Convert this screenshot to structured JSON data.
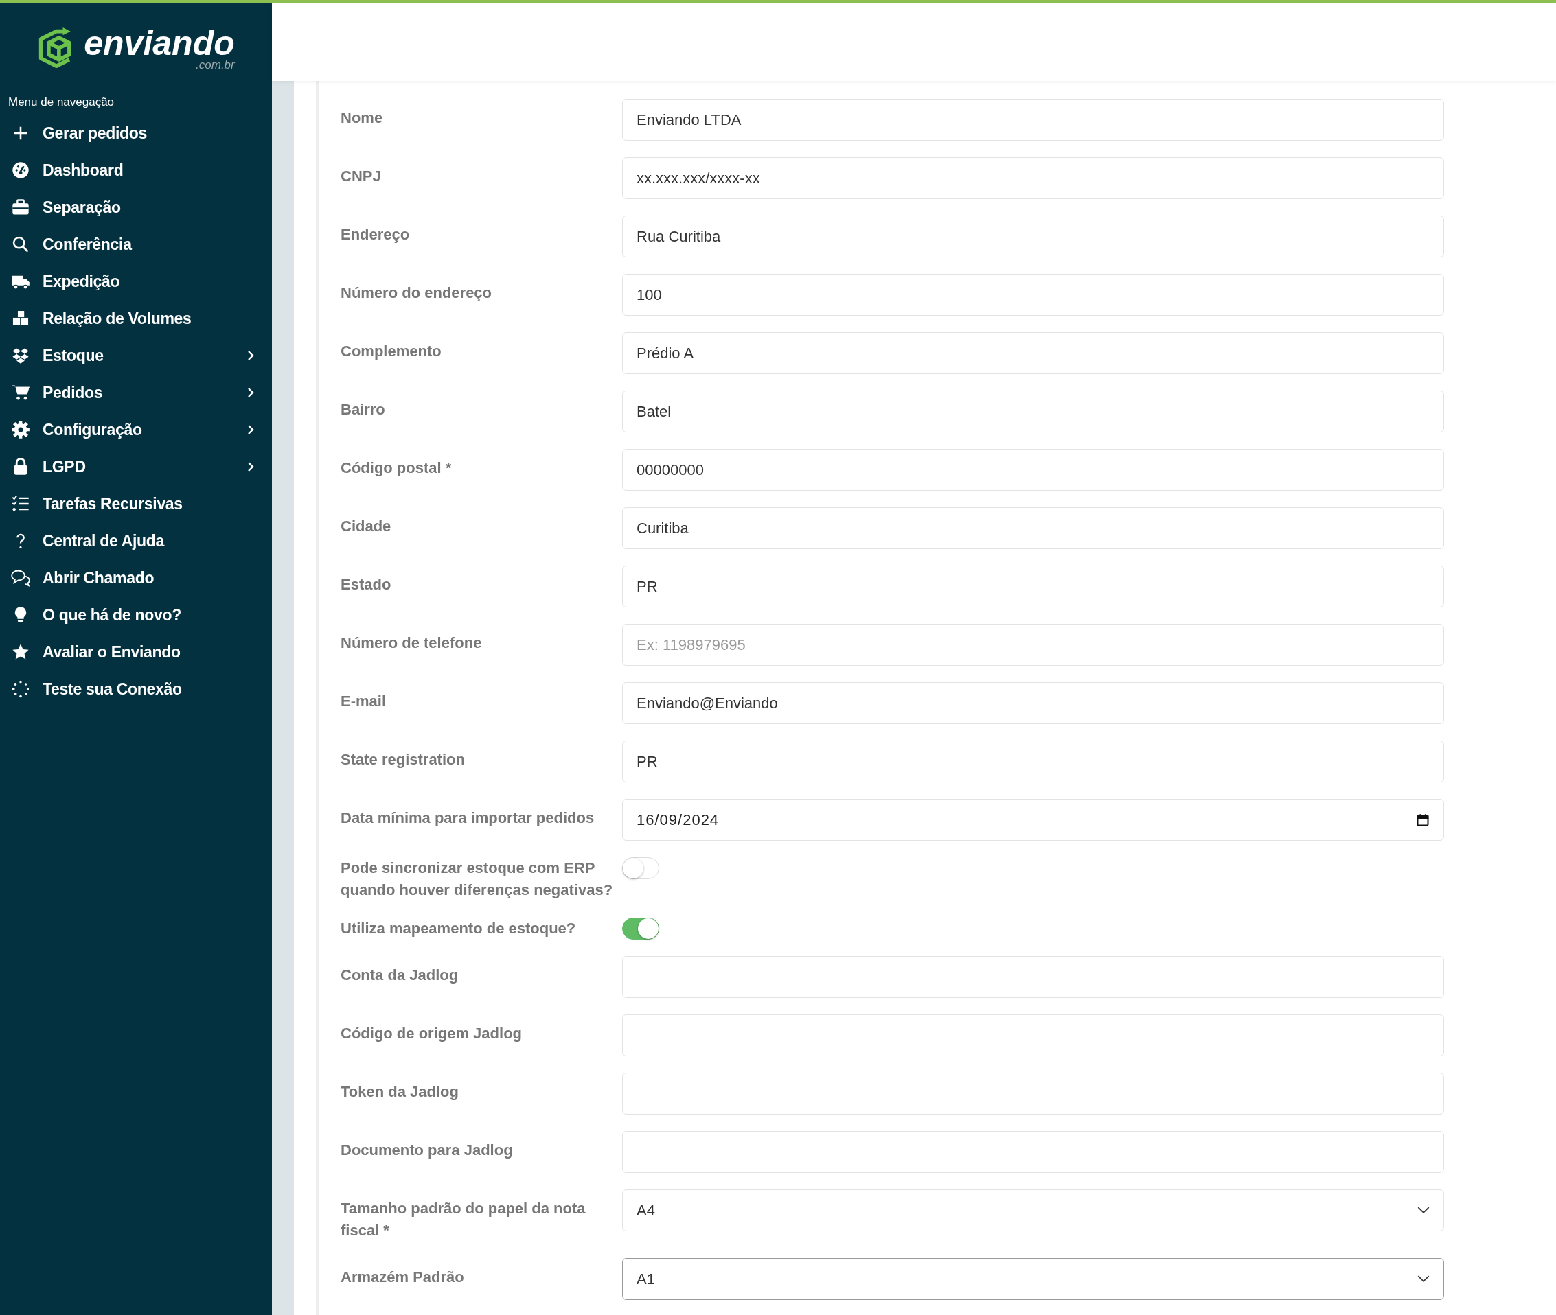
{
  "logo": {
    "name": "enviando",
    "domain": ".com.br"
  },
  "sidebar": {
    "heading": "Menu de navegação",
    "items": [
      {
        "label": "Gerar pedidos",
        "has_submenu": false
      },
      {
        "label": "Dashboard",
        "has_submenu": false
      },
      {
        "label": "Separação",
        "has_submenu": false
      },
      {
        "label": "Conferência",
        "has_submenu": false
      },
      {
        "label": "Expedição",
        "has_submenu": false
      },
      {
        "label": "Relação de Volumes",
        "has_submenu": false
      },
      {
        "label": "Estoque",
        "has_submenu": true
      },
      {
        "label": "Pedidos",
        "has_submenu": true
      },
      {
        "label": "Configuração",
        "has_submenu": true
      },
      {
        "label": "LGPD",
        "has_submenu": true
      },
      {
        "label": "Tarefas Recursivas",
        "has_submenu": false
      },
      {
        "label": "Central de Ajuda",
        "has_submenu": false
      },
      {
        "label": "Abrir Chamado",
        "has_submenu": false
      },
      {
        "label": "O que há de novo?",
        "has_submenu": false
      },
      {
        "label": "Avaliar o Enviando",
        "has_submenu": false
      },
      {
        "label": "Teste sua Conexão",
        "has_submenu": false
      }
    ]
  },
  "form": {
    "fields": [
      {
        "kind": "text",
        "label": "Nome",
        "value": "Enviando LTDA"
      },
      {
        "kind": "text",
        "label": "CNPJ",
        "value": "xx.xxx.xxx/xxxx-xx"
      },
      {
        "kind": "text",
        "label": "Endereço",
        "value": "Rua Curitiba"
      },
      {
        "kind": "text",
        "label": "Número do endereço",
        "value": "100"
      },
      {
        "kind": "text",
        "label": "Complemento",
        "value": "Prédio A"
      },
      {
        "kind": "text",
        "label": "Bairro",
        "value": "Batel"
      },
      {
        "kind": "text",
        "label": "Código postal *",
        "value": "00000000"
      },
      {
        "kind": "text",
        "label": "Cidade",
        "value": "Curitiba"
      },
      {
        "kind": "text",
        "label": "Estado",
        "value": "PR"
      },
      {
        "kind": "text",
        "label": "Número de telefone",
        "placeholder": "Ex: 1198979695"
      },
      {
        "kind": "text",
        "label": "E-mail",
        "value": "Enviando@Enviando"
      },
      {
        "kind": "text",
        "label": "State registration",
        "value": "PR"
      },
      {
        "kind": "date",
        "label": "Data mínima para importar pedidos",
        "value": "16/09/2024"
      },
      {
        "kind": "toggle",
        "label": "Pode sincronizar estoque com ERP quando houver diferenças negativas?",
        "on": false
      },
      {
        "kind": "toggle",
        "label": "Utiliza mapeamento de estoque?",
        "on": true
      },
      {
        "kind": "text",
        "label": "Conta da Jadlog"
      },
      {
        "kind": "text",
        "label": "Código de origem Jadlog"
      },
      {
        "kind": "text",
        "label": "Token da Jadlog"
      },
      {
        "kind": "text",
        "label": "Documento para Jadlog"
      },
      {
        "kind": "select",
        "label": "Tamanho padrão do papel da nota fiscal *",
        "value": "A4",
        "focused": false
      },
      {
        "kind": "select",
        "label": "Armazém Padrão",
        "value": "A1",
        "focused": true
      }
    ]
  }
}
